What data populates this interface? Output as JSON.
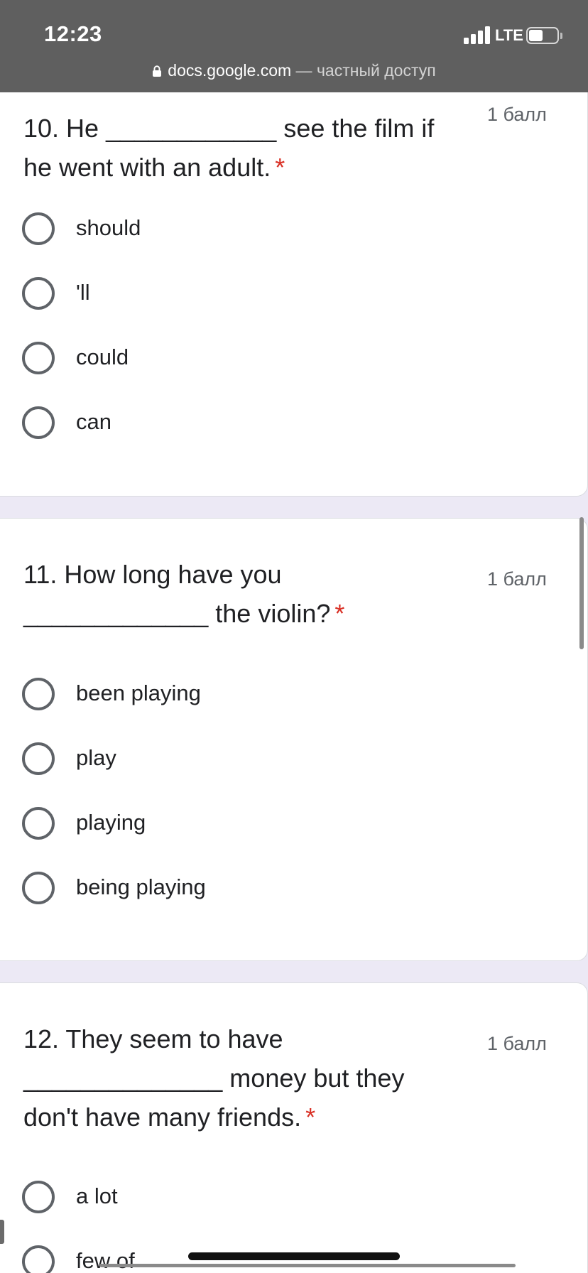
{
  "status_bar": {
    "time": "12:23",
    "network": "LTE",
    "battery_level": 0.4,
    "signal_bars": 4
  },
  "url_bar": {
    "domain": "docs.google.com",
    "suffix": " — частный доступ"
  },
  "questions": [
    {
      "title": "10. He ____________ see the film if he went with an adult.",
      "required_mark": "*",
      "points": "1 балл",
      "options": [
        "should",
        "'ll",
        "could",
        "can"
      ]
    },
    {
      "title": "11. How long have you _____________ the violin?",
      "required_mark": "*",
      "points": "1 балл",
      "options": [
        "been playing",
        "play",
        "playing",
        "being playing"
      ]
    },
    {
      "title": "12. They seem to have ______________ money but they don't have many friends.",
      "required_mark": "*",
      "points": "1 балл",
      "options": [
        "a lot",
        "few of"
      ]
    }
  ],
  "colors": {
    "status_bar_bg": "#5f5f5f",
    "page_bg": "#ece9f5",
    "required": "#d93025"
  }
}
